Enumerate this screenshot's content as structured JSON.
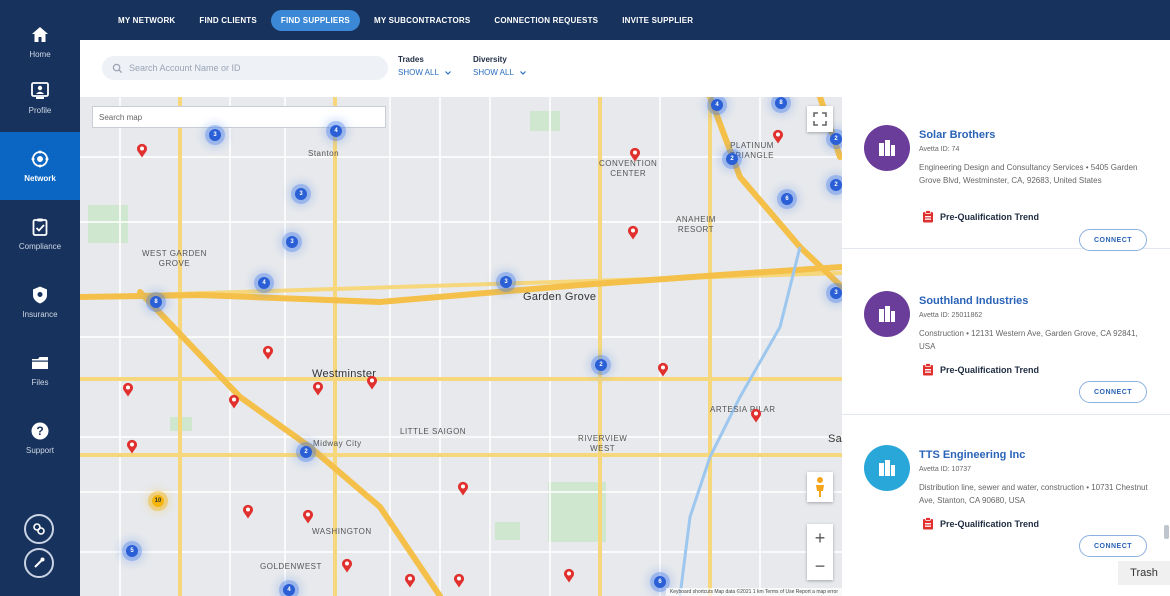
{
  "sidebar": {
    "items": [
      {
        "label": "Home",
        "icon": "home-icon"
      },
      {
        "label": "Profile",
        "icon": "profile-icon"
      },
      {
        "label": "Network",
        "icon": "network-icon"
      },
      {
        "label": "Compliance",
        "icon": "compliance-icon"
      },
      {
        "label": "Insurance",
        "icon": "insurance-icon"
      },
      {
        "label": "Files",
        "icon": "files-icon"
      },
      {
        "label": "Support",
        "icon": "support-icon"
      }
    ],
    "active": "Network",
    "bottom_icons": [
      "link-icon",
      "tool-icon"
    ]
  },
  "topnav": {
    "tabs": [
      "MY NETWORK",
      "FIND CLIENTS",
      "FIND SUPPLIERS",
      "MY SUBCONTRACTORS",
      "CONNECTION REQUESTS",
      "INVITE SUPPLIER"
    ],
    "active": "FIND SUPPLIERS"
  },
  "filters": {
    "search_placeholder": "Search Account Name or ID",
    "trades_label": "Trades",
    "trades_value": "SHOW ALL",
    "diversity_label": "Diversity",
    "diversity_value": "SHOW ALL"
  },
  "map": {
    "search_placeholder": "Search map",
    "labels": {
      "stanton": "Stanton",
      "convention": "CONVENTION\nCENTER",
      "platinum": "PLATINUM\nTRIANGLE",
      "anaheim": "ANAHEIM\nRESORT",
      "west_garden_grove": "WEST GARDEN\nGROVE",
      "garden_grove": "Garden Grove",
      "westminster": "Westminster",
      "little_saigon": "LITTLE SAIGON",
      "midway_city": "Midway City",
      "riverview": "RIVERVIEW\nWEST",
      "artesia": "ARTESIA PILAR",
      "washington": "WASHINGTON",
      "goldenwest": "GOLDENWEST",
      "sa": "Sa"
    },
    "clusters": [
      {
        "count": "3"
      },
      {
        "count": "4"
      },
      {
        "count": "4"
      },
      {
        "count": "8"
      },
      {
        "count": "2"
      },
      {
        "count": "2"
      },
      {
        "count": "3"
      },
      {
        "count": "2"
      },
      {
        "count": "6"
      },
      {
        "count": "3"
      },
      {
        "count": "4"
      },
      {
        "count": "3"
      },
      {
        "count": "8"
      },
      {
        "count": "2"
      },
      {
        "count": "2"
      },
      {
        "count": "5"
      },
      {
        "count": "4"
      },
      {
        "count": "6"
      },
      {
        "count": "3"
      }
    ],
    "yellow_cluster": {
      "count": "10"
    },
    "zoom_in": "+",
    "zoom_out": "−",
    "attribution": "Keyboard shortcuts   Map data ©2021   1 km   Terms of Use   Report a map error"
  },
  "results": [
    {
      "name": "Solar Brothers",
      "avetta_id": "Avetta ID: 74",
      "description": "Engineering Design and Consultancy Services • 5405 Garden Grove Blvd, Westminster, CA, 92683, United States",
      "pq": "Pre-Qualification Trend",
      "connect": "CONNECT",
      "logo_color": "#6a3d9a"
    },
    {
      "name": "Southland Industries",
      "avetta_id": "Avetta ID: 25011862",
      "description": "Construction • 12131 Western Ave, Garden Grove, CA 92841, USA",
      "pq": "Pre-Qualification Trend",
      "connect": "CONNECT",
      "logo_color": "#6a3d9a"
    },
    {
      "name": "TTS Engineering Inc",
      "avetta_id": "Avetta ID: 10737",
      "description": "Distribution line, sewer and water, construction • 10731 Chestnut Ave, Stanton, CA 90680, USA",
      "pq": "Pre-Qualification Trend",
      "connect": "CONNECT",
      "logo_color": "#2aa7d9"
    }
  ],
  "trash_label": "Trash"
}
